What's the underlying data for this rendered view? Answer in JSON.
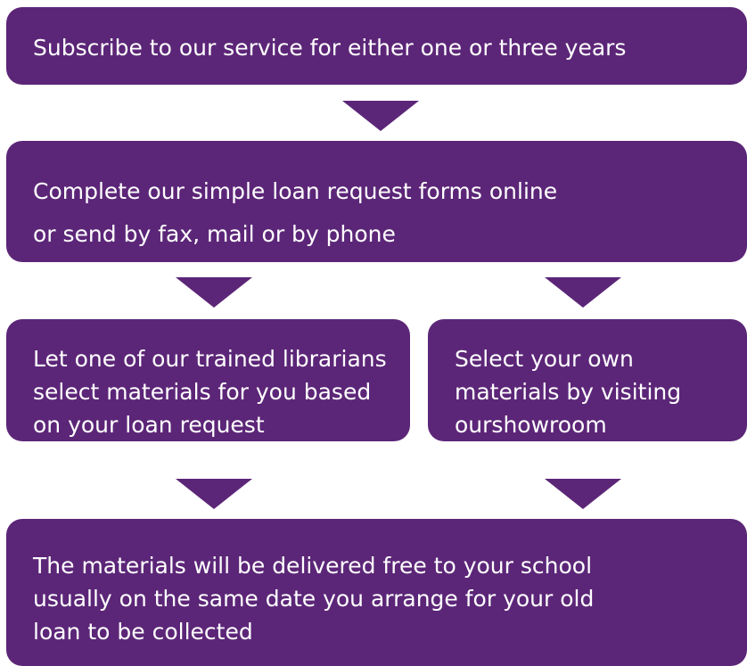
{
  "colors": {
    "box_fill": "#5c2678",
    "text": "#ffffff"
  },
  "steps": {
    "subscribe": {
      "lines": [
        "Subscribe to our service for either one or three years"
      ]
    },
    "request": {
      "lines": [
        "Complete our simple loan request forms online",
        "or send by fax, mail or by phone"
      ]
    },
    "librarian": {
      "lines": [
        "Let one of our trained librarians",
        "select materials for you based",
        "on your loan request"
      ]
    },
    "showroom": {
      "lines": [
        "Select your own",
        "materials by visiting",
        "ourshowroom"
      ]
    },
    "delivery": {
      "lines": [
        "The materials will be delivered free to your school",
        "usually on the same date you arrange for your old",
        "loan to be collected"
      ]
    }
  }
}
